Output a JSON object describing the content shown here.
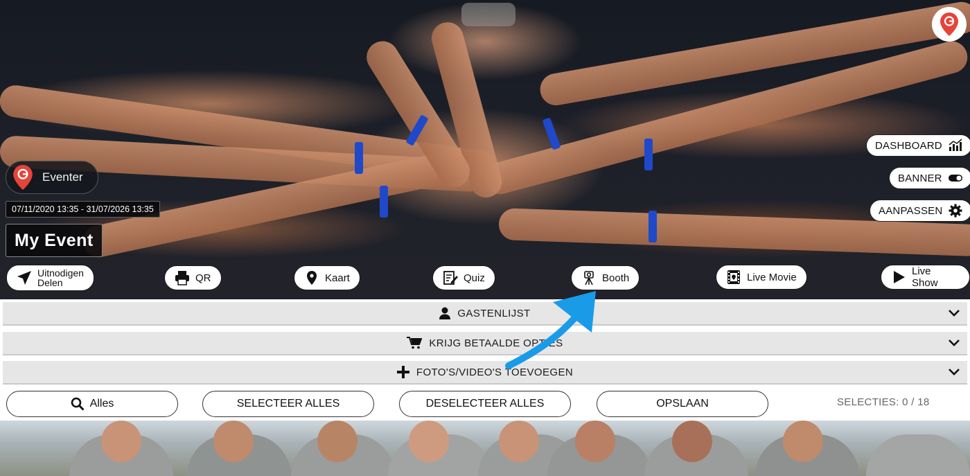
{
  "hero": {
    "brand_label": "Eventer",
    "date_range": "07/11/2020 13:35 - 31/07/2026 13:35",
    "event_title": "My Event",
    "right_buttons": {
      "dashboard": "DASHBOARD",
      "banner": "BANNER",
      "customize": "AANPASSEN"
    },
    "actions": {
      "invite_line1": "Uitnodigen",
      "invite_line2": "Delen",
      "qr": "QR",
      "map": "Kaart",
      "quiz": "Quiz",
      "booth": "Booth",
      "live_movie": "Live Movie",
      "live_show": "Live Show"
    }
  },
  "accordions": {
    "guestlist": "GASTENLIJST",
    "paid_options": "KRIJG BETAALDE OPTIES",
    "add_media": "FOTO'S/VIDEO'S TOEVOEGEN"
  },
  "toolbar": {
    "filter": "Alles",
    "select_all": "SELECTEER ALLES",
    "deselect_all": "DESELECTEER ALLES",
    "save": "OPSLAAN",
    "selections": "SELECTIES: 0 / 18"
  },
  "colors": {
    "brand_red": "#e5443b",
    "annotation_blue": "#1a9be8",
    "band_blue": "#1f49c9"
  }
}
